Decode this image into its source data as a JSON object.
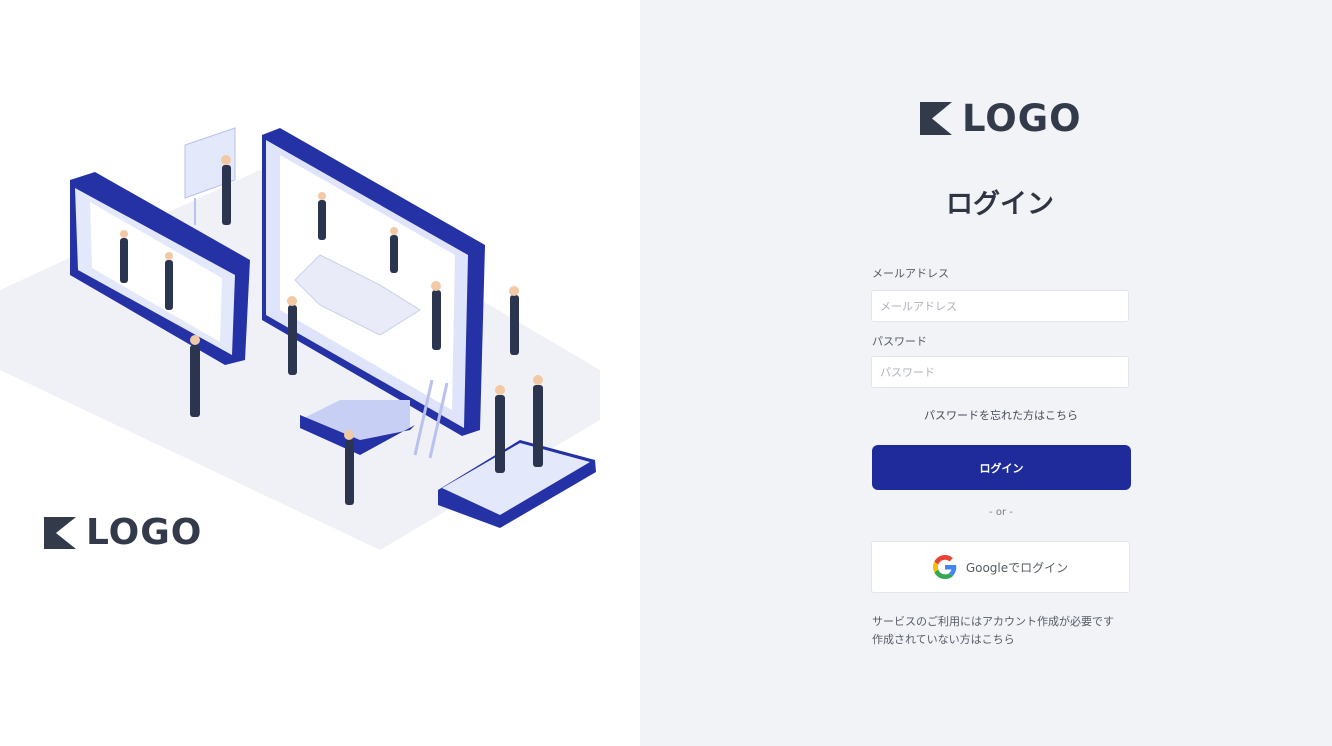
{
  "brand": {
    "logo_text": "LOGO",
    "primary_color": "#1f2a9b",
    "logo_color": "#333b4a"
  },
  "hero": {
    "illustration": "isometric-construction-workers-on-devices"
  },
  "form": {
    "title": "ログイン",
    "email": {
      "label": "メールアドレス",
      "placeholder": "メールアドレス",
      "value": ""
    },
    "password": {
      "label": "パスワード",
      "placeholder": "パスワード",
      "value": ""
    },
    "forgot_link": "パスワードを忘れた方はこちら",
    "login_button": "ログイン",
    "divider": "- or -",
    "google_button": "Googleでログイン",
    "signup_note_line1": "サービスのご利用にはアカウント作成が必要です",
    "signup_note_line2": "作成されていない方はこちら"
  },
  "icons": {
    "logo": "logo-mark-icon",
    "google": "google-g-icon"
  }
}
